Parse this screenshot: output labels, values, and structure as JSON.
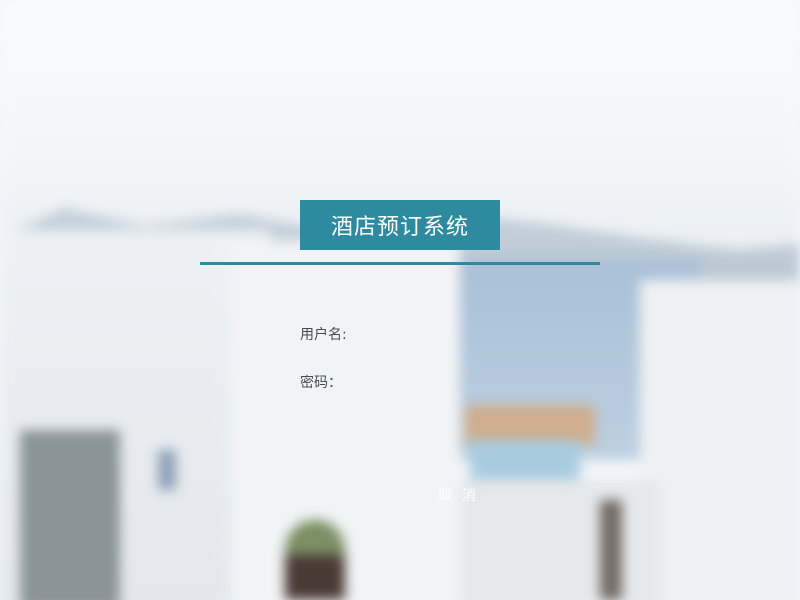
{
  "app": {
    "title": "酒店预订系统"
  },
  "login": {
    "username_label": "用户名:",
    "username_value": "",
    "password_label": "密码：",
    "password_value": "",
    "cancel_label": "取消"
  },
  "colors": {
    "accent": "#2e8a9f",
    "label_text": "#444c52",
    "button_text": "#ffffff"
  }
}
